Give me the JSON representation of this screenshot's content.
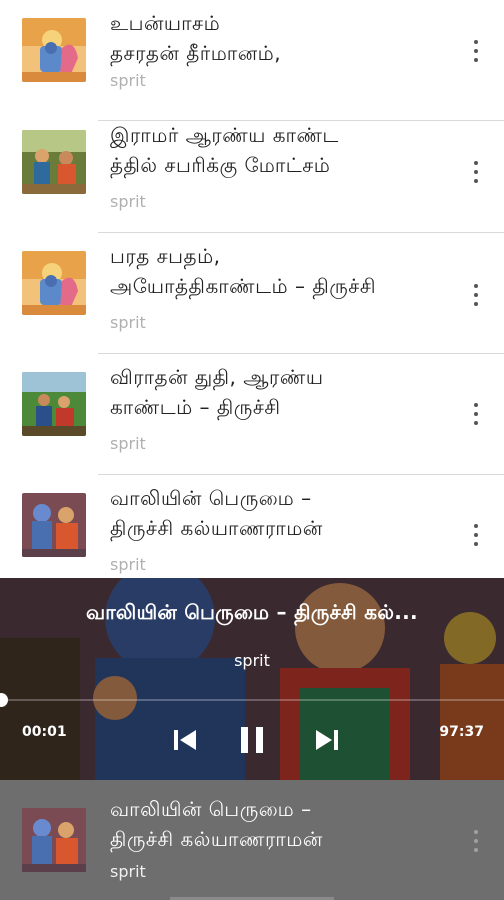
{
  "episodes": [
    {
      "line1": "உபன்யாசம்",
      "line2": "தசரதன் தீர்மானம்,",
      "author": "sprit",
      "icon": "rama-sita-thumbnail"
    },
    {
      "line1": "இராமர் ஆரண்ய காண்ட",
      "line2": "த்தில் சபரிக்கு மோட்சம்",
      "author": "sprit",
      "icon": "rama-forest-thumbnail"
    },
    {
      "line1": "பரத சபதம்,",
      "line2": "அயோத்திகாண்டம் – திருச்சி",
      "author": "sprit",
      "icon": "rama-sita-thumbnail"
    },
    {
      "line1": "விராதன் துதி, ஆரண்ய",
      "line2": "காண்டம் – திருச்சி",
      "author": "sprit",
      "icon": "forest-painting-thumbnail"
    },
    {
      "line1": "வாலியின் பெருமை –",
      "line2": "திருச்சி கல்யாணராமன்",
      "author": "sprit",
      "icon": "rama-sita-portrait-thumbnail"
    }
  ],
  "player": {
    "title": "வாலியின் பெருமை – திருச்சி கல்...",
    "author": "sprit",
    "elapsed": "00:01",
    "duration": "97:37",
    "progress_fraction": 0.0
  },
  "mini_player": {
    "line1": "வாலியின் பெருமை –",
    "line2": "திருச்சி கல்யாணராமன்",
    "author": "sprit"
  }
}
